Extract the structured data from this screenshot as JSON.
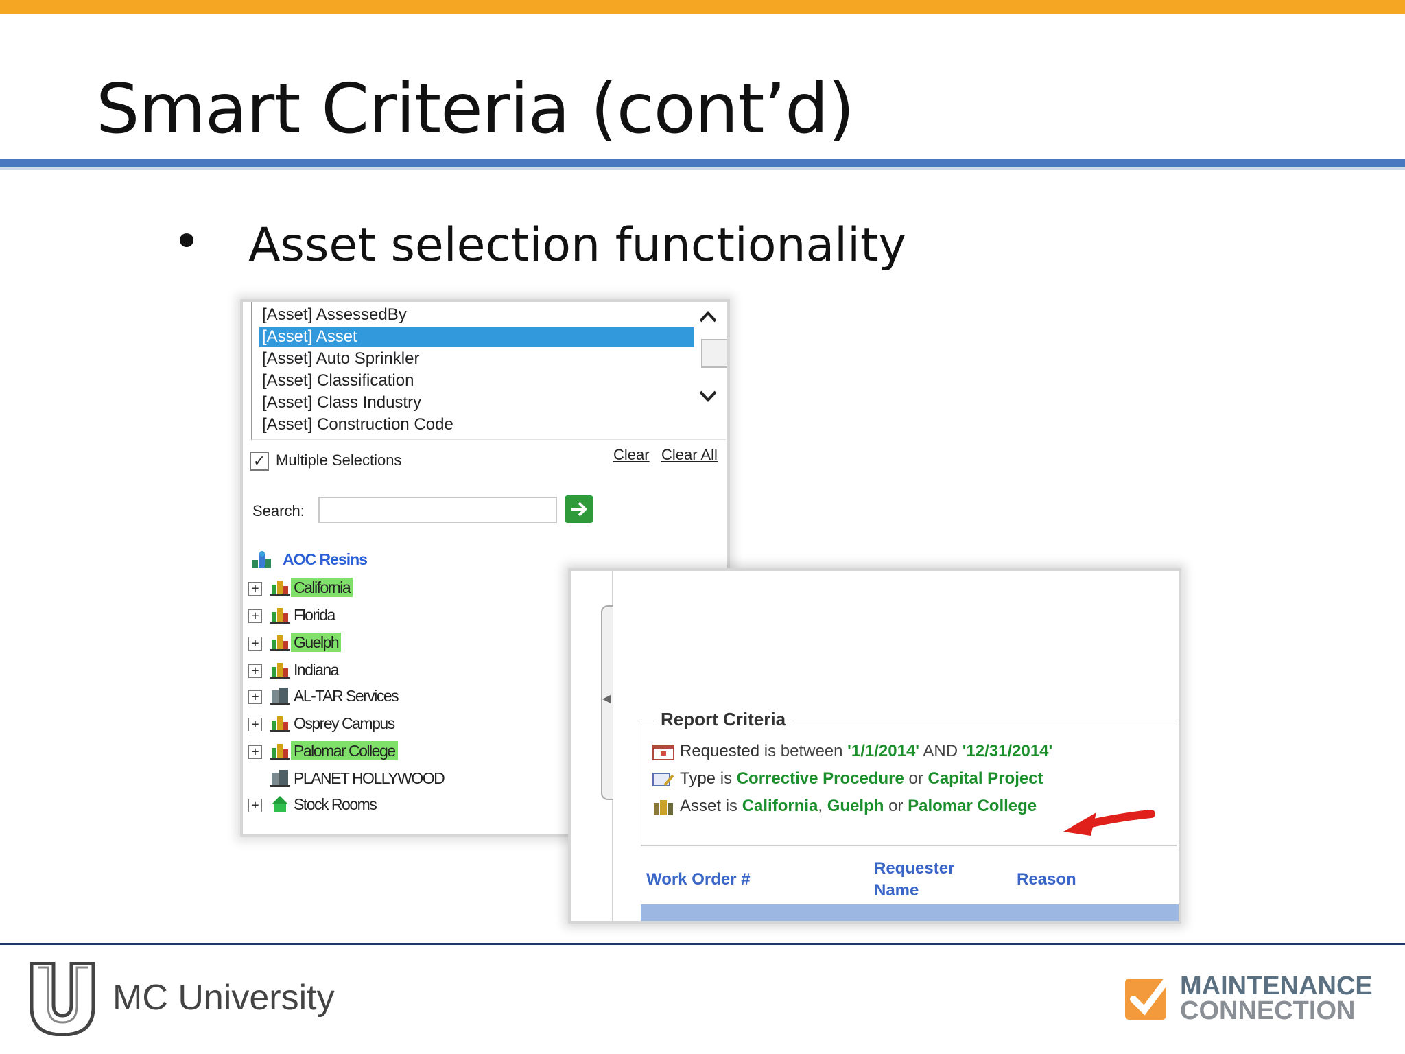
{
  "slide": {
    "title": "Smart Criteria (cont’d)",
    "bullet": "Asset selection functionality"
  },
  "asset_panel": {
    "list_items": [
      {
        "label": "[Asset] AssessedBy",
        "selected": false
      },
      {
        "label": "[Asset] Asset",
        "selected": true
      },
      {
        "label": "[Asset] Auto Sprinkler",
        "selected": false
      },
      {
        "label": "[Asset] Classification",
        "selected": false
      },
      {
        "label": "[Asset] Class Industry",
        "selected": false
      },
      {
        "label": "[Asset] Construction Code",
        "selected": false
      }
    ],
    "multiple_selections_label": "Multiple Selections",
    "multiple_selections_checked": true,
    "clear_label": "Clear",
    "clear_all_label": "Clear All",
    "search_label": "Search:",
    "search_value": "",
    "tree_root": "AOC Resins",
    "tree_items": [
      {
        "label": "California",
        "highlighted": true,
        "expandable": true,
        "icon": "building-colored-icon"
      },
      {
        "label": "Florida",
        "highlighted": false,
        "expandable": true,
        "icon": "building-colored-icon"
      },
      {
        "label": "Guelph",
        "highlighted": true,
        "expandable": true,
        "icon": "building-colored-icon"
      },
      {
        "label": "Indiana",
        "highlighted": false,
        "expandable": true,
        "icon": "building-colored-icon"
      },
      {
        "label": "AL-TAR Services",
        "highlighted": false,
        "expandable": true,
        "icon": "building-gray-icon"
      },
      {
        "label": "Osprey Campus",
        "highlighted": false,
        "expandable": true,
        "icon": "building-colored-icon"
      },
      {
        "label": "Palomar College",
        "highlighted": true,
        "expandable": true,
        "icon": "building-colored-icon"
      },
      {
        "label": "PLANET HOLLYWOOD",
        "highlighted": false,
        "expandable": false,
        "icon": "building-gray-icon"
      },
      {
        "label": "Stock Rooms",
        "highlighted": false,
        "expandable": true,
        "icon": "house-green-icon"
      }
    ]
  },
  "report_panel": {
    "legend": "Report Criteria",
    "criteria": {
      "requested": {
        "label": "Requested",
        "op1": " is between ",
        "v1": "'1/1/2014'",
        "op2": " AND ",
        "v2": "'12/31/2014'"
      },
      "type": {
        "label": "Type",
        "op1": " is ",
        "v1": "Corrective Procedure",
        "op2": " or ",
        "v2": "Capital Project"
      },
      "asset": {
        "label": "Asset",
        "op1": " is ",
        "v1": "California",
        "op2": ", ",
        "v2": "Guelph",
        "op3": " or ",
        "v3": "Palomar College"
      }
    },
    "columns": [
      "Work Order #",
      "Requester Name",
      "Reason"
    ]
  },
  "footer": {
    "university": "MC University",
    "brand_line1": "MAINTENANCE",
    "brand_line2": "CONNECTION"
  },
  "colors": {
    "accent_orange": "#f5a623",
    "title_rule_blue": "#4a78c0",
    "selection_blue": "#3399dd",
    "highlight_green": "#7fe06a",
    "value_green": "#1a8f2b",
    "link_blue": "#3a66c8",
    "arrow_red": "#e0201a"
  }
}
